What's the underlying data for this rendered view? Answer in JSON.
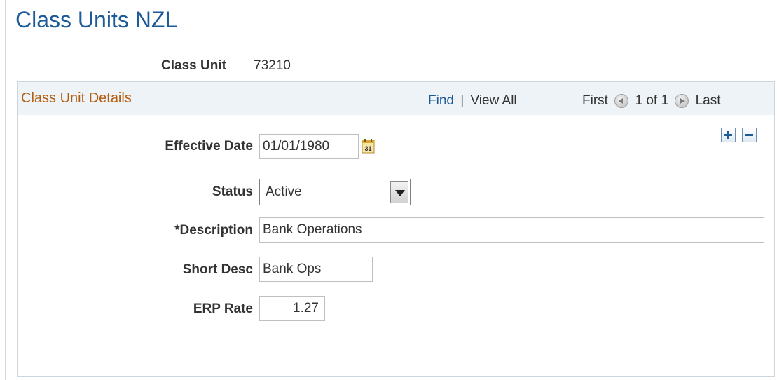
{
  "page": {
    "title": "Class Units NZL"
  },
  "key": {
    "label": "Class Unit",
    "value": "73210"
  },
  "panel": {
    "title": "Class Unit Details",
    "find_label": "Find",
    "separator": "|",
    "view_all_label": "View All",
    "first_label": "First",
    "page_info": "1 of 1",
    "last_label": "Last"
  },
  "fields": {
    "effective_date": {
      "label": "Effective Date",
      "value": "01/01/1980"
    },
    "status": {
      "label": "Status",
      "value": "Active"
    },
    "description": {
      "label": "*Description",
      "value": "Bank Operations"
    },
    "short_desc": {
      "label": "Short Desc",
      "value": "Bank Ops"
    },
    "erp_rate": {
      "label": "ERP Rate",
      "value": "1.27"
    }
  },
  "calendar_icon": {
    "text": "31"
  },
  "icons": {
    "add": "plus-icon",
    "remove": "minus-icon",
    "calendar": "calendar-icon",
    "prev": "arrow-left-icon",
    "next": "arrow-right-icon",
    "dropdown": "chevron-down-icon"
  },
  "colors": {
    "title": "#1d5b96",
    "panel_title": "#b45d0e",
    "link": "#1d5b96",
    "panel_header_bg": "#eef3f8"
  }
}
